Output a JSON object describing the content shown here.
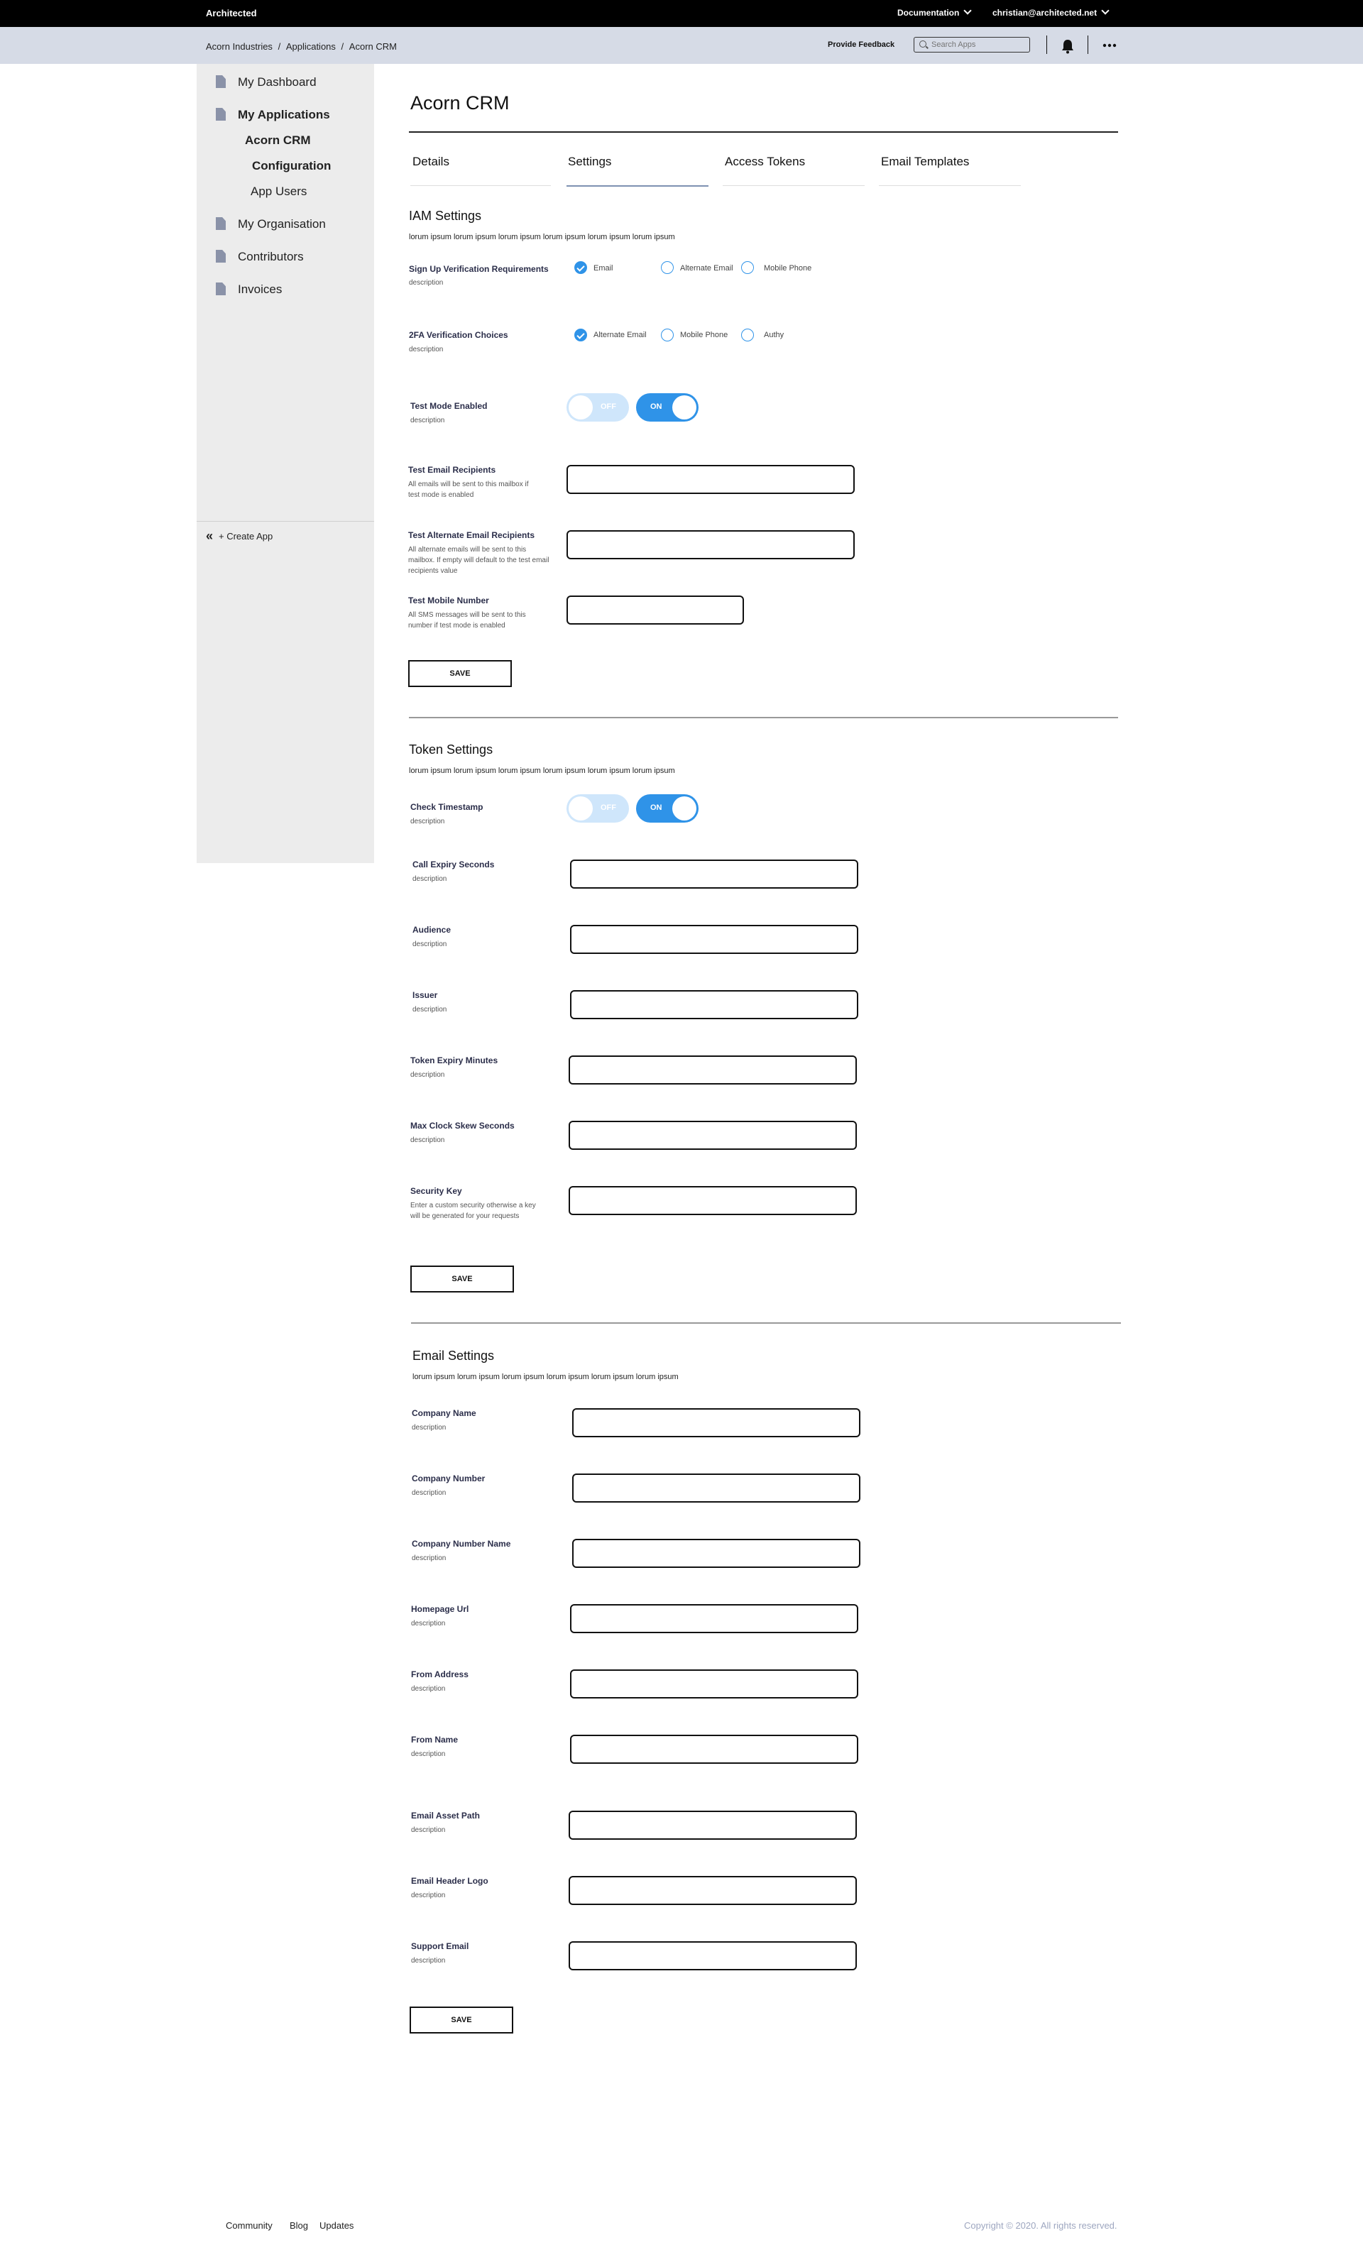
{
  "topbar": {
    "brand": "Architected",
    "documentation": "Documentation",
    "user": "christian@architected.net"
  },
  "subbar": {
    "breadcrumb": [
      "Acorn Industries",
      "Applications",
      "Acorn CRM"
    ],
    "separator": "/",
    "feedback": "Provide Feedback",
    "search_placeholder": "Search Apps"
  },
  "sidebar": {
    "items": [
      {
        "label": "My Dashboard"
      },
      {
        "label": "My Applications"
      },
      {
        "label": "Acorn CRM"
      },
      {
        "label": "Configuration"
      },
      {
        "label": "App Users"
      },
      {
        "label": "My Organisation"
      },
      {
        "label": "Contributors"
      },
      {
        "label": "Invoices"
      }
    ],
    "create_app": "+ Create App"
  },
  "page": {
    "title": "Acorn CRM",
    "tabs": [
      {
        "label": "Details"
      },
      {
        "label": "Settings"
      },
      {
        "label": "Access Tokens"
      },
      {
        "label": "Email Templates"
      }
    ],
    "active_tab": "Settings"
  },
  "iam": {
    "title": "IAM Settings",
    "desc": "lorum ipsum lorum ipsum lorum ipsum lorum ipsum lorum ipsum lorum ipsum",
    "signup": {
      "label": "Sign Up Verification Requirements",
      "desc": "description",
      "options": [
        "Email",
        "Alternate Email",
        "Mobile Phone"
      ],
      "checked": "Email"
    },
    "twofa": {
      "label": "2FA Verification Choices",
      "desc": "description",
      "options": [
        "Alternate Email",
        "Mobile Phone",
        "Authy"
      ],
      "checked": "Alternate Email"
    },
    "test_mode": {
      "label": "Test Mode Enabled",
      "desc": "description",
      "off": "OFF",
      "on": "ON"
    },
    "test_email": {
      "label": "Test Email Recipients",
      "desc": "All  emails will be sent to this mailbox if test mode is enabled",
      "value": ""
    },
    "test_alt_email": {
      "label": "Test Alternate Email Recipients",
      "desc": "All alternate emails will be sent to this mailbox.  If empty will default to the test email recipients value",
      "value": ""
    },
    "test_mobile": {
      "label": "Test Mobile Number",
      "desc": "All SMS messages will be sent to this number if test mode is enabled",
      "value": ""
    },
    "save": "SAVE"
  },
  "token": {
    "title": "Token Settings",
    "desc": "lorum ipsum lorum ipsum lorum ipsum lorum ipsum lorum ipsum lorum ipsum",
    "check_timestamp": {
      "label": "Check Timestamp",
      "desc": "description",
      "off": "OFF",
      "on": "ON"
    },
    "fields": [
      {
        "label": "Call Expiry Seconds",
        "desc": "description",
        "value": ""
      },
      {
        "label": "Audience",
        "desc": "description",
        "value": ""
      },
      {
        "label": "Issuer",
        "desc": "description",
        "value": ""
      },
      {
        "label": "Token Expiry Minutes",
        "desc": "description",
        "value": ""
      },
      {
        "label": "Max Clock Skew Seconds",
        "desc": "description",
        "value": ""
      },
      {
        "label": "Security Key",
        "desc": "Enter a custom security otherwise a key will be generated for your requests",
        "value": ""
      }
    ],
    "save": "SAVE"
  },
  "email": {
    "title": "Email Settings",
    "desc": "lorum ipsum lorum ipsum lorum ipsum lorum ipsum lorum ipsum lorum ipsum",
    "fields": [
      {
        "label": "Company Name",
        "desc": "description",
        "value": ""
      },
      {
        "label": "Company Number",
        "desc": "description",
        "value": ""
      },
      {
        "label": "Company Number Name",
        "desc": "description",
        "value": ""
      },
      {
        "label": "Homepage Url",
        "desc": "description",
        "value": ""
      },
      {
        "label": "From Address",
        "desc": "description",
        "value": ""
      },
      {
        "label": "From Name",
        "desc": "description",
        "value": ""
      },
      {
        "label": "Email Asset Path",
        "desc": "description",
        "value": ""
      },
      {
        "label": "Email Header Logo",
        "desc": "description",
        "value": ""
      },
      {
        "label": "Support Email",
        "desc": "description",
        "value": ""
      }
    ],
    "save": "SAVE"
  },
  "footer": {
    "links": [
      "Community",
      "Blog",
      "Updates"
    ],
    "copyright": "Copyright © 2020. All rights reserved."
  },
  "colors": {
    "accent": "#2f93e8",
    "accent_light": "#cfe6fb",
    "subbar_bg": "#d6dbe6",
    "sidebar_bg": "#ececec",
    "label_color": "#2b2e4a",
    "copyright": "#9ea7c0"
  }
}
